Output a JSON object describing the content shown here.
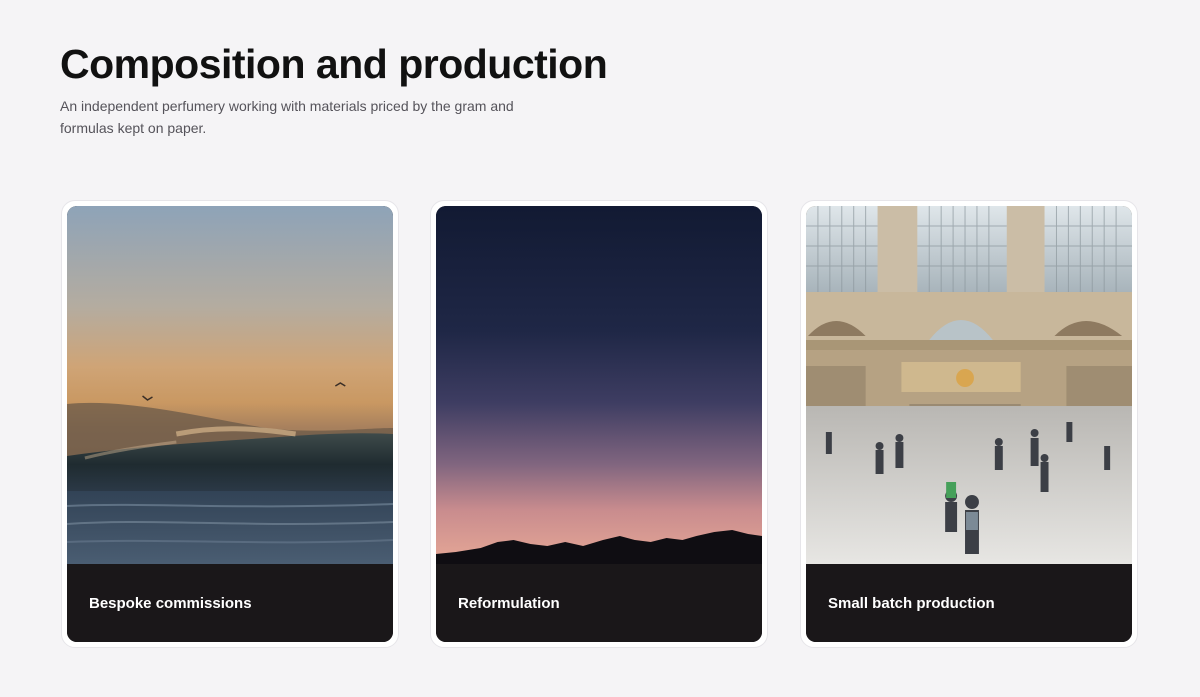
{
  "header": {
    "title": "Composition and production",
    "subtitle": "An independent perfumery working with materials priced by the gram and formulas kept on paper."
  },
  "cards": [
    {
      "label": "Bespoke commissions",
      "image": "ocean-wave-sunset-photo"
    },
    {
      "label": "Reformulation",
      "image": "mountain-silhouette-dusk-photo"
    },
    {
      "label": "Small batch production",
      "image": "train-station-concourse-photo"
    }
  ],
  "colors": {
    "background": "#f5f4f6",
    "card_footer": "#1a1719",
    "title": "#111111",
    "subtitle": "#55535a"
  }
}
